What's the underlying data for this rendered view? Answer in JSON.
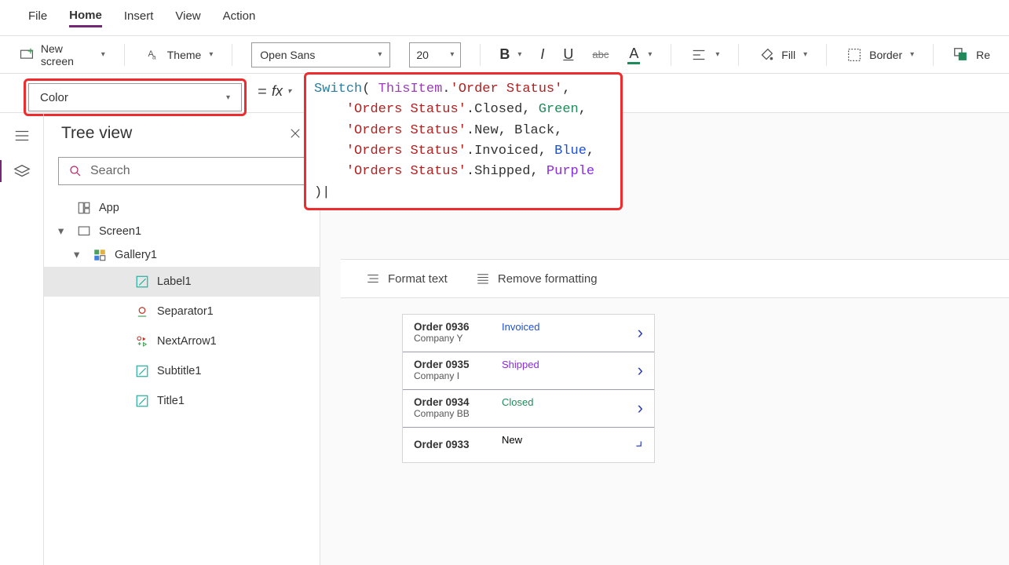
{
  "menu": {
    "file": "File",
    "home": "Home",
    "insert": "Insert",
    "view": "View",
    "action": "Action"
  },
  "ribbon": {
    "new_screen": "New screen",
    "theme": "Theme",
    "font": "Open Sans",
    "size": "20",
    "fill": "Fill",
    "border": "Border",
    "reorder": "Re"
  },
  "property_dropdown": "Color",
  "formula": {
    "line1_pre": "Switch",
    "line1_paren": "(",
    "line1_this": " ThisItem",
    "line1_dot": ".",
    "line1_field": "'Order Status'",
    "line1_tail": ",",
    "line2_field": "    'Orders Status'",
    "line2_mid": ".Closed, ",
    "line2_color": "Green",
    "line2_tail": ",",
    "line3_field": "    'Orders Status'",
    "line3_mid": ".New, ",
    "line3_color": "Black",
    "line3_tail": ",",
    "line4_field": "    'Orders Status'",
    "line4_mid": ".Invoiced, ",
    "line4_color": "Blue",
    "line4_tail": ",",
    "line5_field": "    'Orders Status'",
    "line5_mid": ".Shipped, ",
    "line5_color": "Purple",
    "line6_close": ")"
  },
  "format_bar": {
    "format": "Format text",
    "remove": "Remove formatting"
  },
  "tree": {
    "title": "Tree view",
    "search_placeholder": "Search",
    "app": "App",
    "screen": "Screen1",
    "gallery": "Gallery1",
    "label": "Label1",
    "separator": "Separator1",
    "nextarrow": "NextArrow1",
    "subtitle": "Subtitle1",
    "ttl": "Title1"
  },
  "orders": [
    {
      "title": "Order 0936",
      "sub": "Company Y",
      "status": "Invoiced",
      "status_class": "st-invoiced"
    },
    {
      "title": "Order 0935",
      "sub": "Company I",
      "status": "Shipped",
      "status_class": "st-shipped"
    },
    {
      "title": "Order 0934",
      "sub": "Company BB",
      "status": "Closed",
      "status_class": "st-closed"
    },
    {
      "title": "Order 0933",
      "sub": "",
      "status": "New",
      "status_class": "st-new"
    }
  ]
}
